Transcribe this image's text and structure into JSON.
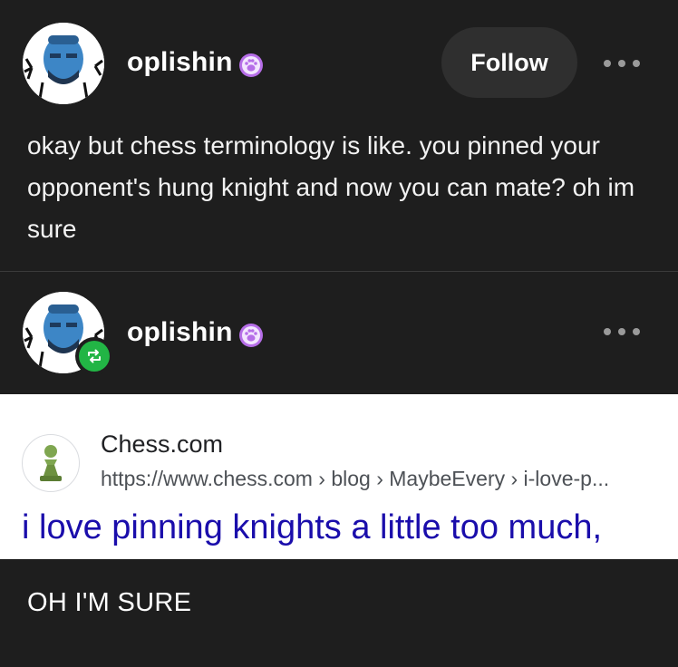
{
  "post1": {
    "username": "oplishin",
    "follow_label": "Follow",
    "text": "okay but chess terminology is like. you pinned your opponent's hung knight and now you can mate? oh im sure"
  },
  "post2": {
    "username": "oplishin",
    "search_result": {
      "site_name": "Chess.com",
      "url": "https://www.chess.com › blog › MaybeEvery › i-love-p...",
      "title": "i love pinning knights a little too much,"
    },
    "caption": "OH I'M SURE"
  },
  "icons": {
    "avatar": "avatar",
    "paw_badge": "paw-badge-icon",
    "more": "more-options-icon",
    "reblog": "reblog-icon",
    "favicon": "chess-pawn-icon"
  },
  "colors": {
    "background": "#1e1e1e",
    "follow_button": "#2f2f2f",
    "reblog_green": "#22b545",
    "link_blue": "#1a0dab",
    "paw_purple": "#b66ee8"
  }
}
